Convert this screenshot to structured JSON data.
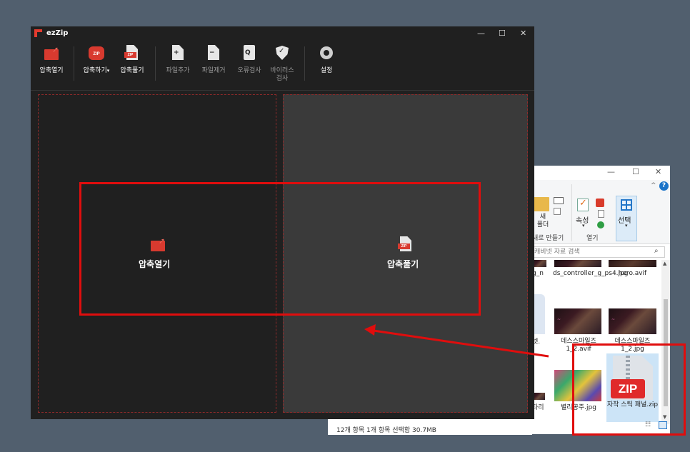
{
  "explorer": {
    "window_buttons": {
      "minimize": "—",
      "maximize": "☐",
      "close": "✕"
    },
    "ribbon": {
      "collapse": "^",
      "help": "?",
      "new_folder_line1": "새",
      "new_folder_line2": "폴더",
      "group_new": "새로 만들기",
      "properties": "속성",
      "group_open": "열기",
      "select": "선택",
      "dropdown_arrow": "▾"
    },
    "search_placeholder": "캐비넷 자료 검색",
    "search_icon": "⌕",
    "items": [
      {
        "name": "g_n"
      },
      {
        "name": "ds_controller_g_ps4.jpg"
      },
      {
        "name": "hero.avif"
      },
      {
        "name": "넷."
      },
      {
        "name": "데스스마일즈 1_2.avif"
      },
      {
        "name": "데스스마일즈 1_2.jpg"
      },
      {
        "name": "타리"
      },
      {
        "name": "별리공주.jpg"
      },
      {
        "name": "자작 스틱 패널.zip"
      }
    ],
    "zip_badge": "ZIP",
    "scroll_up": "▲",
    "scroll_down": "▼",
    "status": "12개 항목    1개 항목 선택함 30.7MB"
  },
  "ezzip": {
    "title": "ezZip",
    "window_buttons": {
      "minimize": "—",
      "maximize": "☐",
      "close": "✕"
    },
    "toolbar": [
      {
        "label": "압축열기",
        "icon": "folder-open-icon",
        "enabled": true
      },
      {
        "label": "압축하기",
        "icon": "cloud-zip-icon",
        "enabled": true
      },
      {
        "label": "압축풀기",
        "icon": "zip-file-icon",
        "enabled": true
      },
      {
        "label": "파일추가",
        "icon": "file-add-icon",
        "enabled": false
      },
      {
        "label": "파일제거",
        "icon": "file-remove-icon",
        "enabled": false
      },
      {
        "label": "오류검사",
        "icon": "error-check-icon",
        "enabled": false
      },
      {
        "label": "바이러스\n검사",
        "icon": "virus-scan-icon",
        "enabled": false
      },
      {
        "label": "설정",
        "icon": "settings-icon",
        "enabled": true
      }
    ],
    "toolbar_dropdown": "▾",
    "zip_badge": "ZIP",
    "pane_open": {
      "label": "압축열기",
      "icon": "folder-open-icon"
    },
    "pane_extract": {
      "label": "압축풀기",
      "icon": "zip-file-icon"
    }
  },
  "annotation_color": "#e00d0d"
}
